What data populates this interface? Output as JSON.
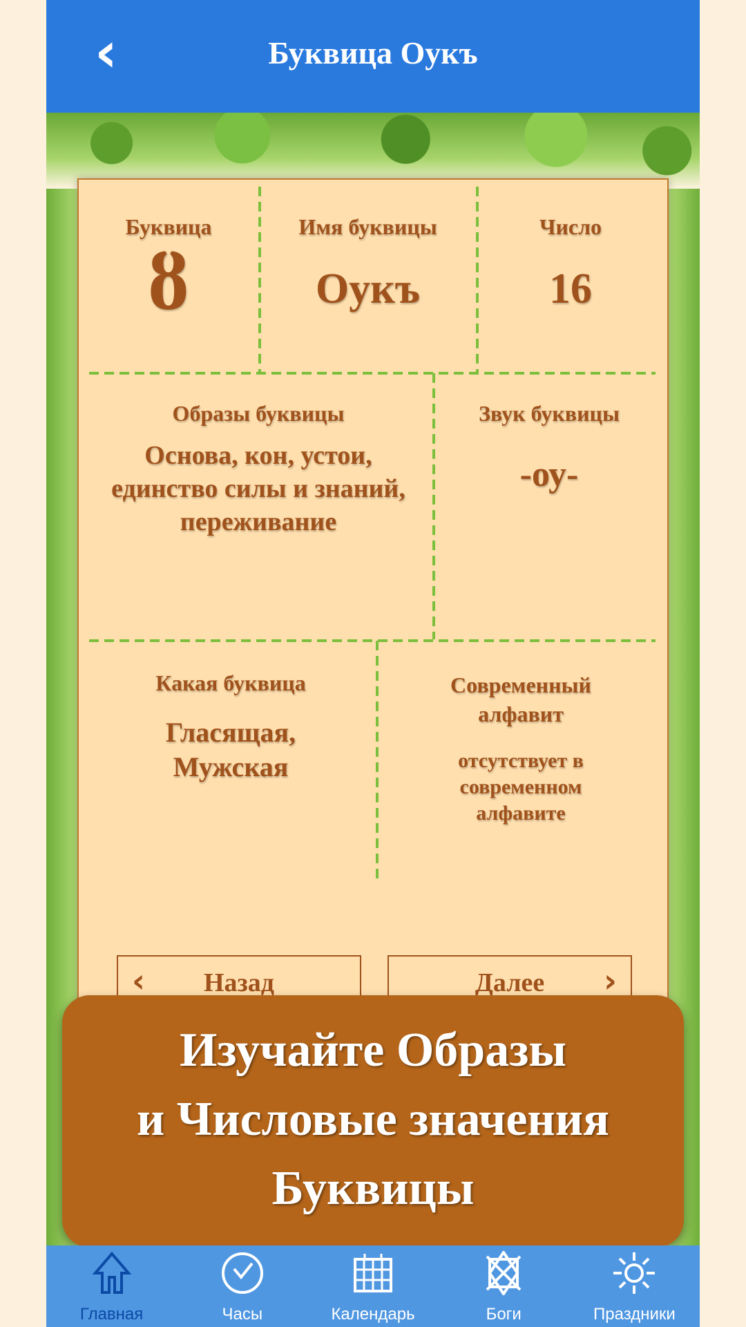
{
  "header": {
    "title": "Буквица Оукъ",
    "back_icon": "chevron-left-icon"
  },
  "card": {
    "bukvica_label": "Буквица",
    "bukvica_value": "ȣ",
    "name_label": "Имя буквицы",
    "name_value": "Оукъ",
    "number_label": "Число",
    "number_value": "16",
    "images_label": "Образы буквицы",
    "images_value": "Основа, кон, устои, единство силы и знаний, переживание",
    "sound_label": "Звук буквицы",
    "sound_value": "-оу-",
    "kind_label": "Какая буквица",
    "kind_value": "Гласящая, Мужская",
    "modern_label": "Современный алфавит",
    "modern_value": "отсутствует в современном алфавите",
    "prev_label": "Назад",
    "next_label": "Далее"
  },
  "banner": {
    "line1": "Изучайте Образы",
    "line2": "и Числовые значения",
    "line3": "Буквицы"
  },
  "tabs": [
    {
      "label": "Главная",
      "icon": "home-icon",
      "active": true
    },
    {
      "label": "Часы",
      "icon": "clock-icon"
    },
    {
      "label": "Календарь",
      "icon": "calendar-icon"
    },
    {
      "label": "Боги",
      "icon": "star-knot-icon"
    },
    {
      "label": "Праздники",
      "icon": "sun-icon"
    }
  ],
  "colors": {
    "header": "#2a7ade",
    "tabbar": "#5097e2",
    "text_brown": "#a0521c",
    "card": "#ffdfae",
    "banner": "#b4651a"
  }
}
